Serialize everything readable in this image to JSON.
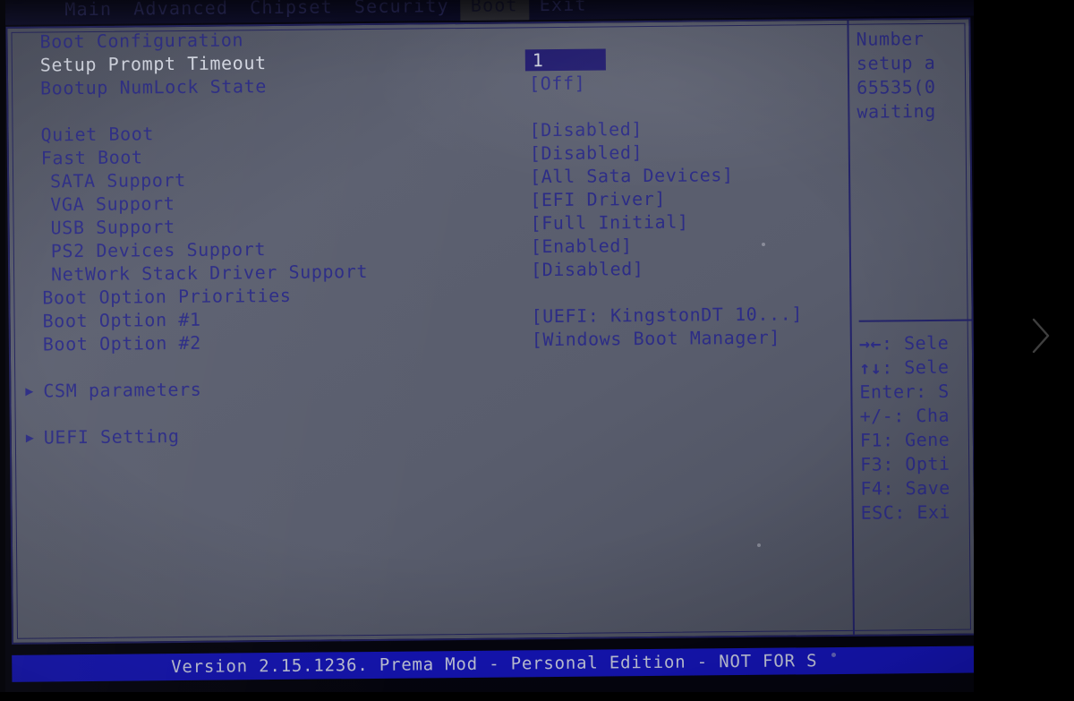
{
  "menubar": {
    "items": [
      {
        "label": "Main",
        "active": false
      },
      {
        "label": "Advanced",
        "active": false
      },
      {
        "label": "Chipset",
        "active": false
      },
      {
        "label": "Security",
        "active": false
      },
      {
        "label": "Boot",
        "active": true
      },
      {
        "label": "Exit",
        "active": false
      }
    ]
  },
  "settings": {
    "section_title": "Boot Configuration",
    "rows": [
      {
        "label": "Setup Prompt Timeout",
        "value": "1",
        "selected": true,
        "boxed": true,
        "indent": 0,
        "submenu": false
      },
      {
        "label": "Bootup NumLock State",
        "value": "[Off]",
        "selected": false,
        "boxed": false,
        "indent": 0,
        "submenu": false
      },
      {
        "label": "Quiet Boot",
        "value": "[Disabled]",
        "selected": false,
        "boxed": false,
        "indent": 0,
        "submenu": false
      },
      {
        "label": "Fast Boot",
        "value": "[Disabled]",
        "selected": false,
        "boxed": false,
        "indent": 0,
        "submenu": false
      },
      {
        "label": "SATA Support",
        "value": "[All Sata Devices]",
        "selected": false,
        "boxed": false,
        "indent": 1,
        "submenu": false
      },
      {
        "label": "VGA Support",
        "value": "[EFI Driver]",
        "selected": false,
        "boxed": false,
        "indent": 1,
        "submenu": false
      },
      {
        "label": "USB Support",
        "value": "[Full Initial]",
        "selected": false,
        "boxed": false,
        "indent": 1,
        "submenu": false
      },
      {
        "label": "PS2 Devices Support",
        "value": "[Enabled]",
        "selected": false,
        "boxed": false,
        "indent": 1,
        "submenu": false
      },
      {
        "label": "NetWork Stack Driver Support",
        "value": "[Disabled]",
        "selected": false,
        "boxed": false,
        "indent": 1,
        "submenu": false
      }
    ],
    "priorities_title": "Boot Option Priorities",
    "boot_options": [
      {
        "label": "Boot Option #1",
        "value": "[UEFI: KingstonDT 10...]"
      },
      {
        "label": "Boot Option #2",
        "value": "[Windows Boot Manager]"
      }
    ],
    "submenus": [
      {
        "label": "CSM parameters",
        "marker": "triangle-right-icon"
      },
      {
        "label": "UEFI Setting",
        "marker": "triangle-right-icon"
      }
    ]
  },
  "help": {
    "lines": [
      "Number",
      "setup a",
      "65535(0",
      "waiting"
    ]
  },
  "keys": {
    "lines": [
      {
        "glyph": "→←",
        "text": ": Sele"
      },
      {
        "glyph": "↑↓",
        "text": ": Sele"
      },
      {
        "glyph": "",
        "text": "Enter: S"
      },
      {
        "glyph": "",
        "text": "+/-: Cha"
      },
      {
        "glyph": "",
        "text": "F1: Gene"
      },
      {
        "glyph": "",
        "text": "F3: Opti"
      },
      {
        "glyph": "",
        "text": "F4: Save"
      },
      {
        "glyph": "",
        "text": "ESC: Exi"
      }
    ]
  },
  "footer": {
    "text": "Version 2.15.1236. Prema Mod - Personal Edition - NOT FOR S"
  },
  "overlay": {
    "next_label": "chevron-right-icon"
  },
  "colors": {
    "panel_text": "#2c2c86",
    "panel_bg": "#595d6d",
    "selected_text": "#d9dde8",
    "value_box_bg": "#201a6e",
    "footer_bg": "#1515b8",
    "menubar_bg": "#0b0b28",
    "border": "#20205e"
  }
}
